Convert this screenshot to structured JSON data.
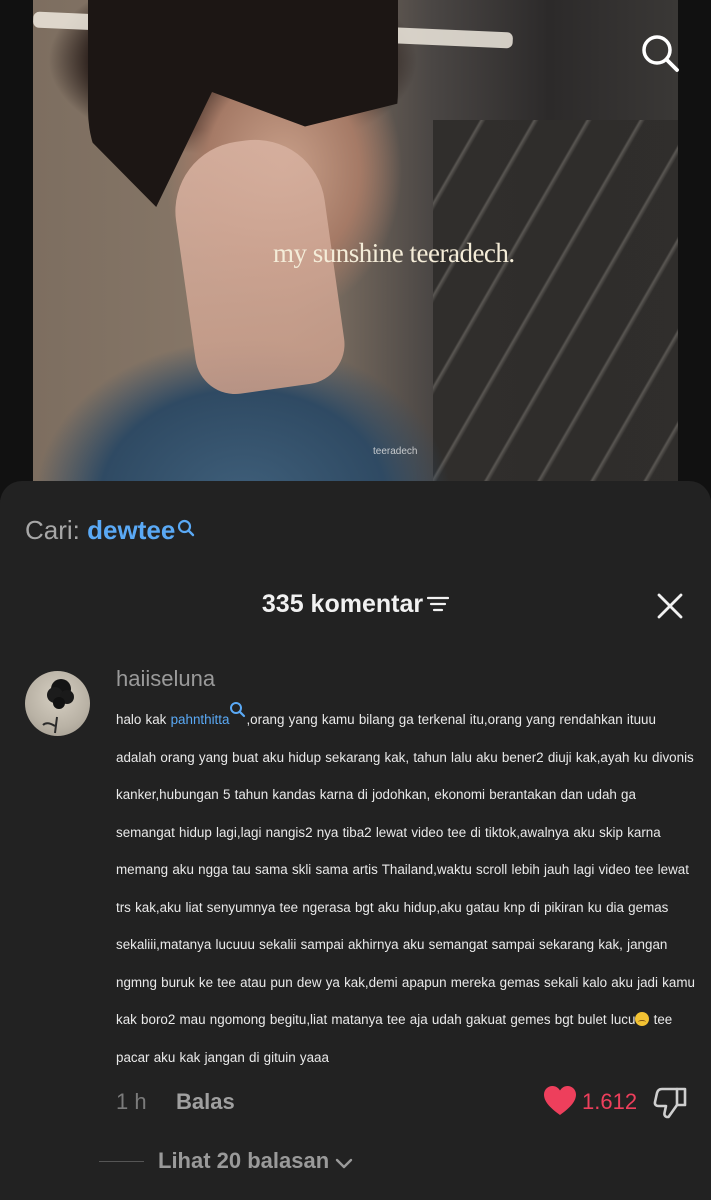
{
  "video": {
    "caption": "my sunshine teeradech.",
    "watermark": "teeradech"
  },
  "search_suggestion": {
    "prefix": "Cari:",
    "term": "dewtee"
  },
  "comments_header": {
    "count_label": "335 komentar"
  },
  "comment": {
    "username": "haiiseluna",
    "text_before_mention": "halo kak ",
    "mention": "pahnthitta",
    "text_after_mention": ",orang yang kamu bilang ga terkenal itu,orang yang rendahkan ituuu adalah orang yang buat aku hidup sekarang kak, tahun lalu aku bener2 diuji kak,ayah ku divonis kanker,hubungan 5 tahun kandas karna di jodohkan, ekonomi berantakan dan udah ga semangat hidup lagi,lagi nangis2 nya tiba2 lewat video tee di tiktok,awalnya aku skip karna memang aku ngga tau sama skli sama artis Thailand,waktu scroll lebih jauh lagi video tee lewat trs kak,aku liat senyumnya tee ngerasa bgt aku hidup,aku gatau knp di pikiran ku dia gemas sekaliii,matanya lucuuu sekalii sampai akhirnya aku semangat sampai sekarang kak, jangan ngmng buruk ke tee atau pun dew ya kak,demi apapun mereka gemas sekali kalo aku jadi kamu kak boro2 mau ngomong begitu,liat matanya tee aja udah gakuat gemes bgt bulet lucu",
    "text_end": " tee pacar aku kak jangan di gituin yaaa",
    "time": "1 h",
    "reply_label": "Balas",
    "like_count": "1.612"
  },
  "replies": {
    "view_label": "Lihat 20 balasan"
  },
  "colors": {
    "accent_blue": "#5aa9f5",
    "like_red": "#ee3f5c",
    "sheet_bg": "#222222"
  },
  "icons": [
    "search-icon",
    "sort-icon",
    "close-icon",
    "heart-icon",
    "dislike-icon",
    "chevron-down-icon",
    "emoji-icon"
  ]
}
